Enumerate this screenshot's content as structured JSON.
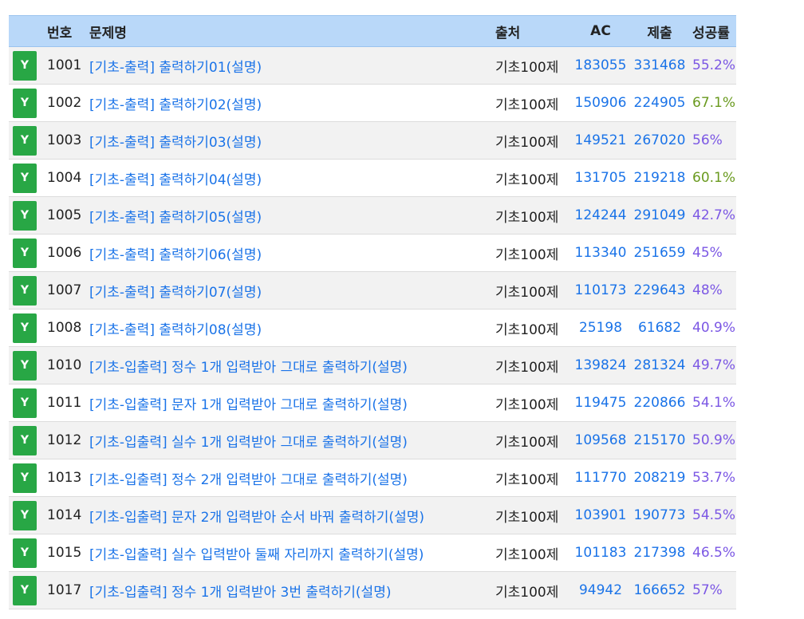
{
  "header": {
    "id": "번호",
    "title": "문제명",
    "source": "출처",
    "ac": "AC",
    "submissions": "제출",
    "rate": "성공률"
  },
  "colors": {
    "header_bg": "#b9d8f9",
    "link": "#1a73e8",
    "badge": "#28a745",
    "rate_normal": "#7b57e4",
    "rate_high": "#6a9a1f"
  },
  "rows": [
    {
      "badge": "Y",
      "id": "1001",
      "title": "[기초-출력] 출력하기01(설명)",
      "source": "기초100제",
      "ac": "183055",
      "submissions": "331468",
      "rate": "55.2%",
      "rate_color": "#7b57e4"
    },
    {
      "badge": "Y",
      "id": "1002",
      "title": "[기초-출력] 출력하기02(설명)",
      "source": "기초100제",
      "ac": "150906",
      "submissions": "224905",
      "rate": "67.1%",
      "rate_color": "#6a9a1f"
    },
    {
      "badge": "Y",
      "id": "1003",
      "title": "[기초-출력] 출력하기03(설명)",
      "source": "기초100제",
      "ac": "149521",
      "submissions": "267020",
      "rate": "56%",
      "rate_color": "#7b57e4"
    },
    {
      "badge": "Y",
      "id": "1004",
      "title": "[기초-출력] 출력하기04(설명)",
      "source": "기초100제",
      "ac": "131705",
      "submissions": "219218",
      "rate": "60.1%",
      "rate_color": "#6a9a1f"
    },
    {
      "badge": "Y",
      "id": "1005",
      "title": "[기초-출력] 출력하기05(설명)",
      "source": "기초100제",
      "ac": "124244",
      "submissions": "291049",
      "rate": "42.7%",
      "rate_color": "#7b57e4"
    },
    {
      "badge": "Y",
      "id": "1006",
      "title": "[기초-출력] 출력하기06(설명)",
      "source": "기초100제",
      "ac": "113340",
      "submissions": "251659",
      "rate": "45%",
      "rate_color": "#7b57e4"
    },
    {
      "badge": "Y",
      "id": "1007",
      "title": "[기초-출력] 출력하기07(설명)",
      "source": "기초100제",
      "ac": "110173",
      "submissions": "229643",
      "rate": "48%",
      "rate_color": "#7b57e4"
    },
    {
      "badge": "Y",
      "id": "1008",
      "title": "[기초-출력] 출력하기08(설명)",
      "source": "기초100제",
      "ac": "25198",
      "submissions": "61682",
      "rate": "40.9%",
      "rate_color": "#7b57e4"
    },
    {
      "badge": "Y",
      "id": "1010",
      "title": "[기초-입출력] 정수 1개 입력받아 그대로 출력하기(설명)",
      "source": "기초100제",
      "ac": "139824",
      "submissions": "281324",
      "rate": "49.7%",
      "rate_color": "#7b57e4"
    },
    {
      "badge": "Y",
      "id": "1011",
      "title": "[기초-입출력] 문자 1개 입력받아 그대로 출력하기(설명)",
      "source": "기초100제",
      "ac": "119475",
      "submissions": "220866",
      "rate": "54.1%",
      "rate_color": "#7b57e4"
    },
    {
      "badge": "Y",
      "id": "1012",
      "title": "[기초-입출력] 실수 1개 입력받아 그대로 출력하기(설명)",
      "source": "기초100제",
      "ac": "109568",
      "submissions": "215170",
      "rate": "50.9%",
      "rate_color": "#7b57e4"
    },
    {
      "badge": "Y",
      "id": "1013",
      "title": "[기초-입출력] 정수 2개 입력받아 그대로 출력하기(설명)",
      "source": "기초100제",
      "ac": "111770",
      "submissions": "208219",
      "rate": "53.7%",
      "rate_color": "#7b57e4"
    },
    {
      "badge": "Y",
      "id": "1014",
      "title": "[기초-입출력] 문자 2개 입력받아 순서 바꿔 출력하기(설명)",
      "source": "기초100제",
      "ac": "103901",
      "submissions": "190773",
      "rate": "54.5%",
      "rate_color": "#7b57e4"
    },
    {
      "badge": "Y",
      "id": "1015",
      "title": "[기초-입출력] 실수 입력받아 둘째 자리까지 출력하기(설명)",
      "source": "기초100제",
      "ac": "101183",
      "submissions": "217398",
      "rate": "46.5%",
      "rate_color": "#7b57e4"
    },
    {
      "badge": "Y",
      "id": "1017",
      "title": "[기초-입출력] 정수 1개 입력받아 3번 출력하기(설명)",
      "source": "기초100제",
      "ac": "94942",
      "submissions": "166652",
      "rate": "57%",
      "rate_color": "#7b57e4"
    }
  ]
}
